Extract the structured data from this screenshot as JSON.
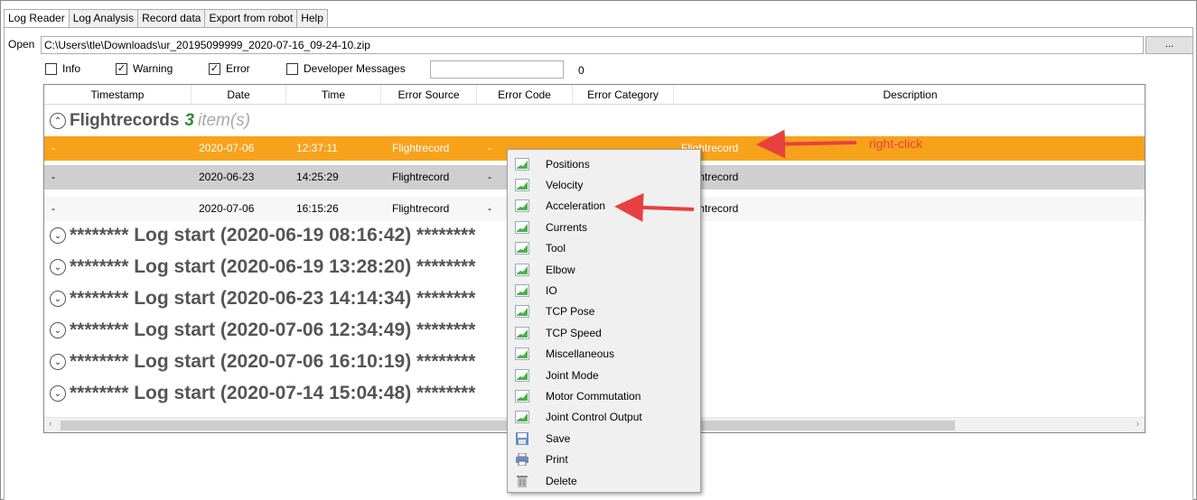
{
  "tabs": [
    "Log Reader",
    "Log Analysis",
    "Record data",
    "Export from robot",
    "Help"
  ],
  "open": {
    "label": "Open",
    "path": "C:\\Users\\tle\\Downloads\\ur_20195099999_2020-07-16_09-24-10.zip",
    "browse_label": "..."
  },
  "filters": {
    "info": {
      "label": "Info",
      "checked": false
    },
    "warning": {
      "label": "Warning",
      "checked": true
    },
    "error": {
      "label": "Error",
      "checked": true
    },
    "developer": {
      "label": "Developer Messages",
      "checked": false
    },
    "search_value": "",
    "count": "0"
  },
  "columns": [
    "Timestamp",
    "Date",
    "Time",
    "Error Source",
    "Error Code",
    "Error Category",
    "Description"
  ],
  "group": {
    "title": "Flightrecords",
    "count": "3",
    "items_label": "item(s)"
  },
  "rows": [
    {
      "timestamp": "-",
      "date": "2020-07-06",
      "time": "12:37:11",
      "source": "Flightrecord",
      "code": "-",
      "category": "",
      "description": "Flightrecord"
    },
    {
      "timestamp": "-",
      "date": "2020-06-23",
      "time": "14:25:29",
      "source": "Flightrecord",
      "code": "-",
      "category": "",
      "description": "Flightrecord"
    },
    {
      "timestamp": "-",
      "date": "2020-07-06",
      "time": "16:15:26",
      "source": "Flightrecord",
      "code": "-",
      "category": "",
      "description": "Flightrecord"
    }
  ],
  "log_groups": [
    "******** Log start (2020-06-19 08:16:42) ********",
    "******** Log start (2020-06-19 13:28:20) ********",
    "******** Log start (2020-06-23 14:14:34) ********",
    "******** Log start (2020-07-06 12:34:49) ********",
    "******** Log start (2020-07-06 16:10:19) ********",
    "******** Log start (2020-07-14 15:04:48) ********"
  ],
  "context_menu": {
    "items": [
      {
        "label": "Positions",
        "icon": "chart-icon"
      },
      {
        "label": "Velocity",
        "icon": "chart-icon"
      },
      {
        "label": "Acceleration",
        "icon": "chart-icon"
      },
      {
        "label": "Currents",
        "icon": "chart-icon"
      },
      {
        "label": "Tool",
        "icon": "chart-icon"
      },
      {
        "label": "Elbow",
        "icon": "chart-icon"
      },
      {
        "label": "IO",
        "icon": "chart-icon"
      },
      {
        "label": "TCP Pose",
        "icon": "chart-icon"
      },
      {
        "label": "TCP Speed",
        "icon": "chart-icon"
      },
      {
        "label": "Miscellaneous",
        "icon": "chart-icon"
      },
      {
        "label": "Joint Mode",
        "icon": "chart-icon"
      },
      {
        "label": "Motor Commutation",
        "icon": "chart-icon"
      },
      {
        "label": "Joint Control Output",
        "icon": "chart-icon"
      },
      {
        "label": "Save",
        "icon": "save-icon"
      },
      {
        "label": "Print",
        "icon": "print-icon"
      },
      {
        "label": "Delete",
        "icon": "delete-icon"
      }
    ]
  },
  "annotation": {
    "right_click": "right-click"
  },
  "colors": {
    "selected_row": "#f7a21b",
    "annotation_red": "#e84040"
  }
}
